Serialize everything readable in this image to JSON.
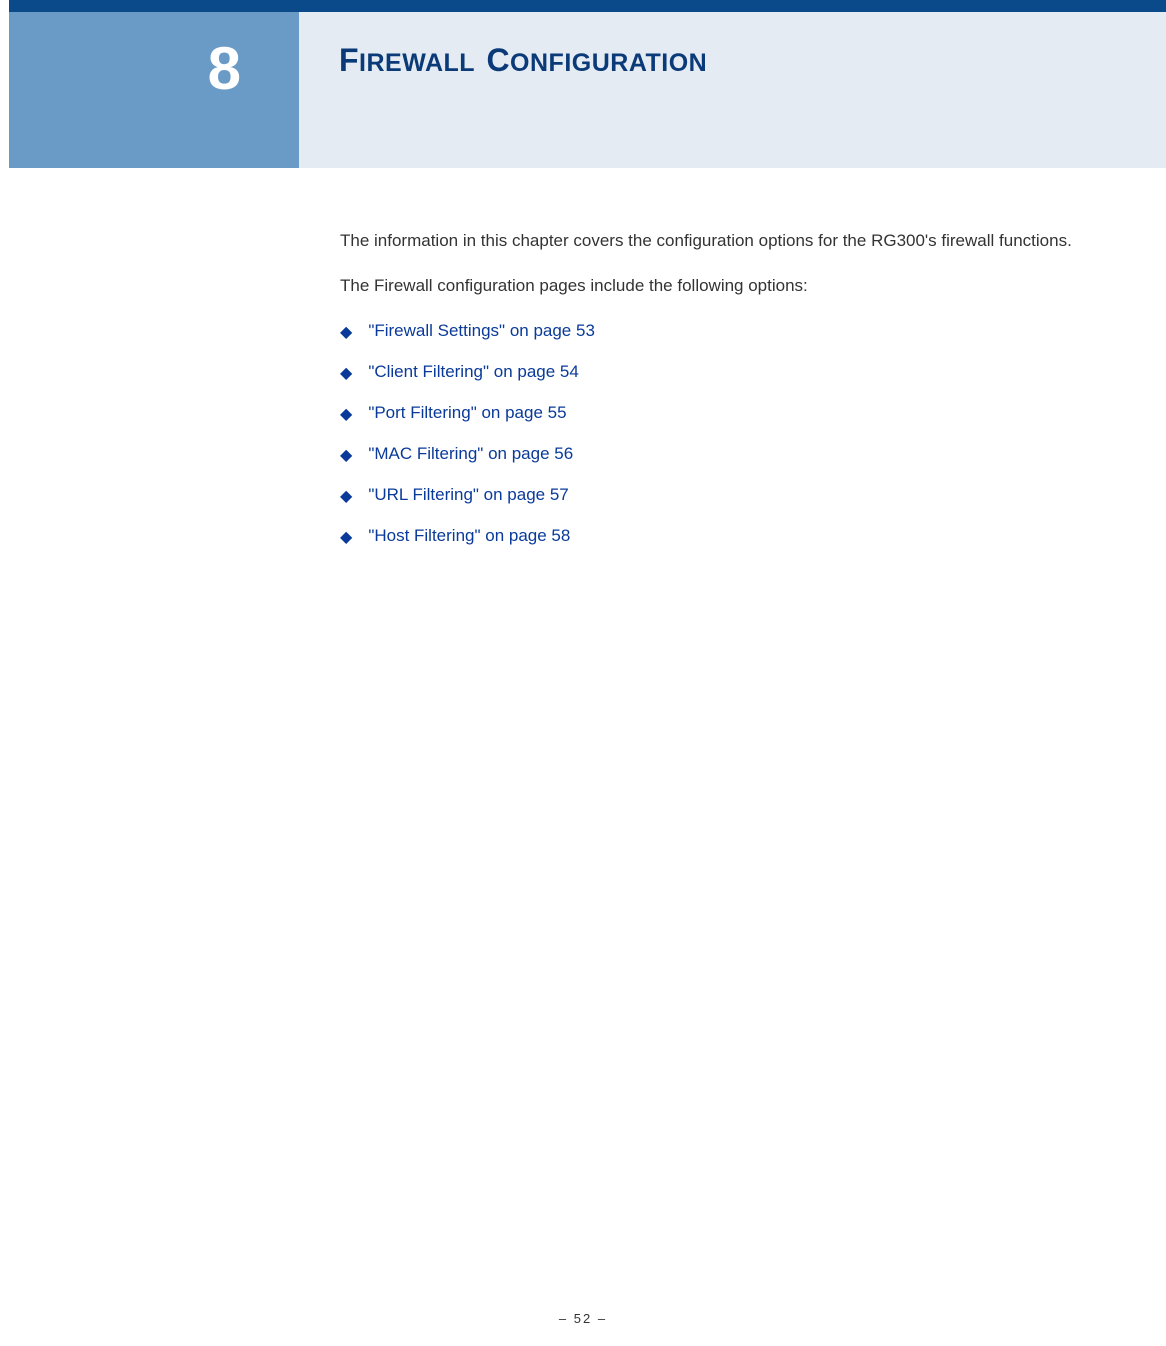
{
  "header": {
    "chapter_number": "8",
    "title_html": "<span class='cap'>F</span><span class='rest'>IREWALL</span> <span class='cap'>C</span><span class='rest'>ONFIGURATION</span>"
  },
  "body": {
    "intro1": "The information in this chapter covers the configuration options for the RG300's firewall functions.",
    "intro2": "The Firewall configuration pages include the following options:",
    "links": [
      {
        "label": "\"Firewall Settings\" on page 53"
      },
      {
        "label": "\"Client Filtering\" on page 54"
      },
      {
        "label": "\"Port Filtering\" on page 55"
      },
      {
        "label": "\"MAC Filtering\" on page 56"
      },
      {
        "label": "\"URL Filtering\" on page 57"
      },
      {
        "label": "\"Host Filtering\" on page 58"
      }
    ]
  },
  "footer": {
    "page_label": "–  52  –"
  }
}
